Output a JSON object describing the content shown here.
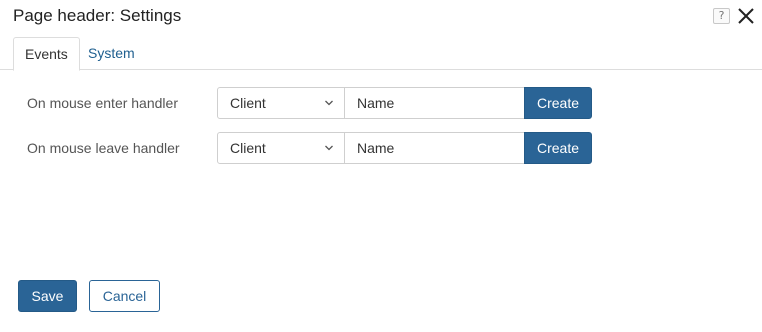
{
  "dialog": {
    "title": "Page header: Settings",
    "help_icon": "question-icon",
    "help_label": "?",
    "close_icon": "close-icon"
  },
  "tabs": [
    {
      "label": "Events",
      "active": true
    },
    {
      "label": "System",
      "active": false
    }
  ],
  "handlers": [
    {
      "label": "On mouse enter handler",
      "type": "Client",
      "name_placeholder": "Name",
      "create_label": "Create"
    },
    {
      "label": "On mouse leave handler",
      "type": "Client",
      "name_placeholder": "Name",
      "create_label": "Create"
    }
  ],
  "footer": {
    "save_label": "Save",
    "cancel_label": "Cancel"
  },
  "colors": {
    "accent": "#2a6496",
    "tab_link": "#1f5f8f",
    "border": "#cfcfcf"
  }
}
